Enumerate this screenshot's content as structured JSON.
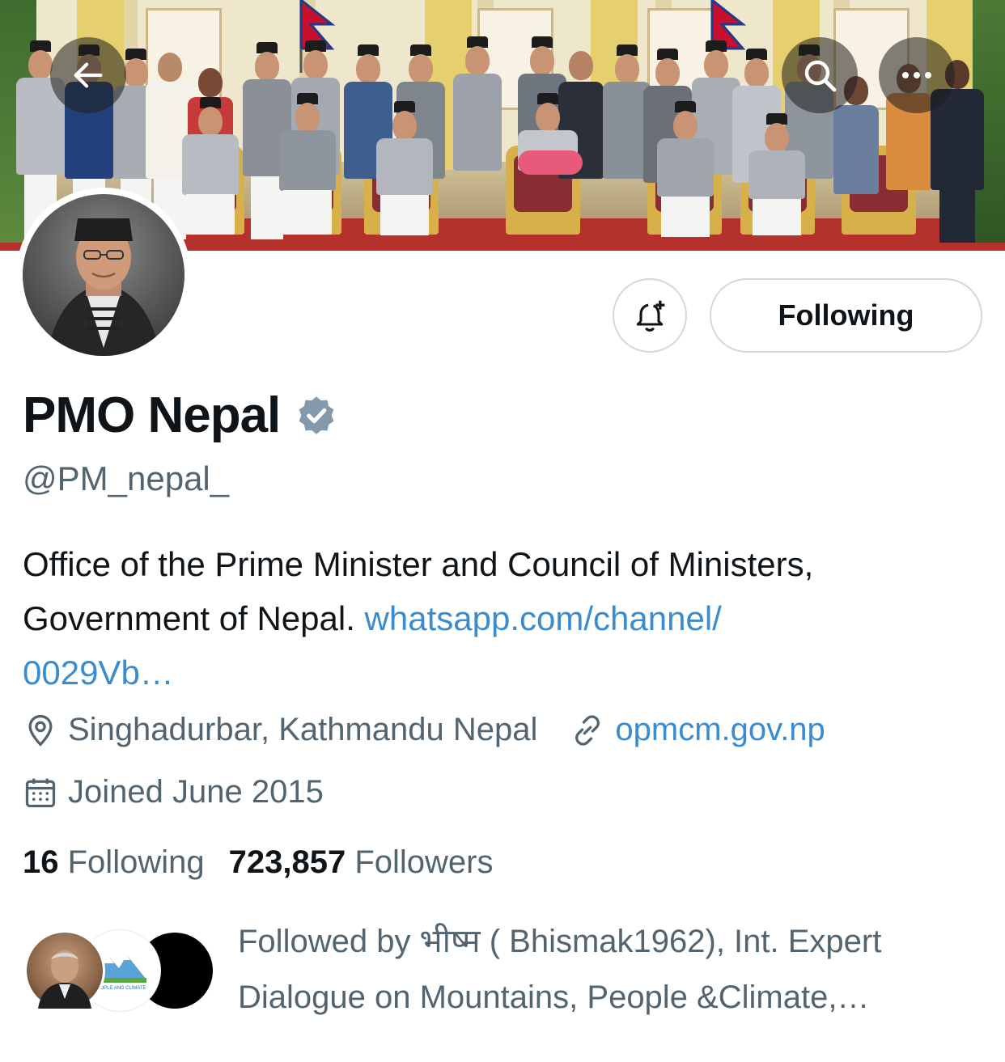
{
  "header": {
    "back_icon": "arrow-left-icon",
    "search_icon": "search-icon",
    "more_icon": "more-horizontal-icon"
  },
  "profile": {
    "name": "PMO Nepal",
    "handle": "@PM_nepal_",
    "verified": true,
    "verified_color": "#829aab",
    "bio_text": "Office of the Prime Minister and Council of Ministers, Government of Nepal. ",
    "bio_link_line1": "whatsapp.com/channel/",
    "bio_link_line2": "0029Vb…",
    "location": "Singhadurbar, Kathmandu Nepal",
    "website": "opmcm.gov.np",
    "joined": "Joined June 2015"
  },
  "actions": {
    "notify_icon": "bell-plus-icon",
    "following_label": "Following"
  },
  "stats": {
    "following_count": "16",
    "following_label": "Following",
    "followers_count": "723,857",
    "followers_label": "Followers"
  },
  "followed_by": {
    "line1": "Followed by भीष्म ( Bhismak1962), Int. Expert",
    "line2": "Dialogue on Mountains, People &Climate,…",
    "badge_text": "PEOPLE AND CLIMATE"
  },
  "colors": {
    "link": "#3a8ccf",
    "secondary_text": "#536471",
    "border": "#cfd9de"
  }
}
